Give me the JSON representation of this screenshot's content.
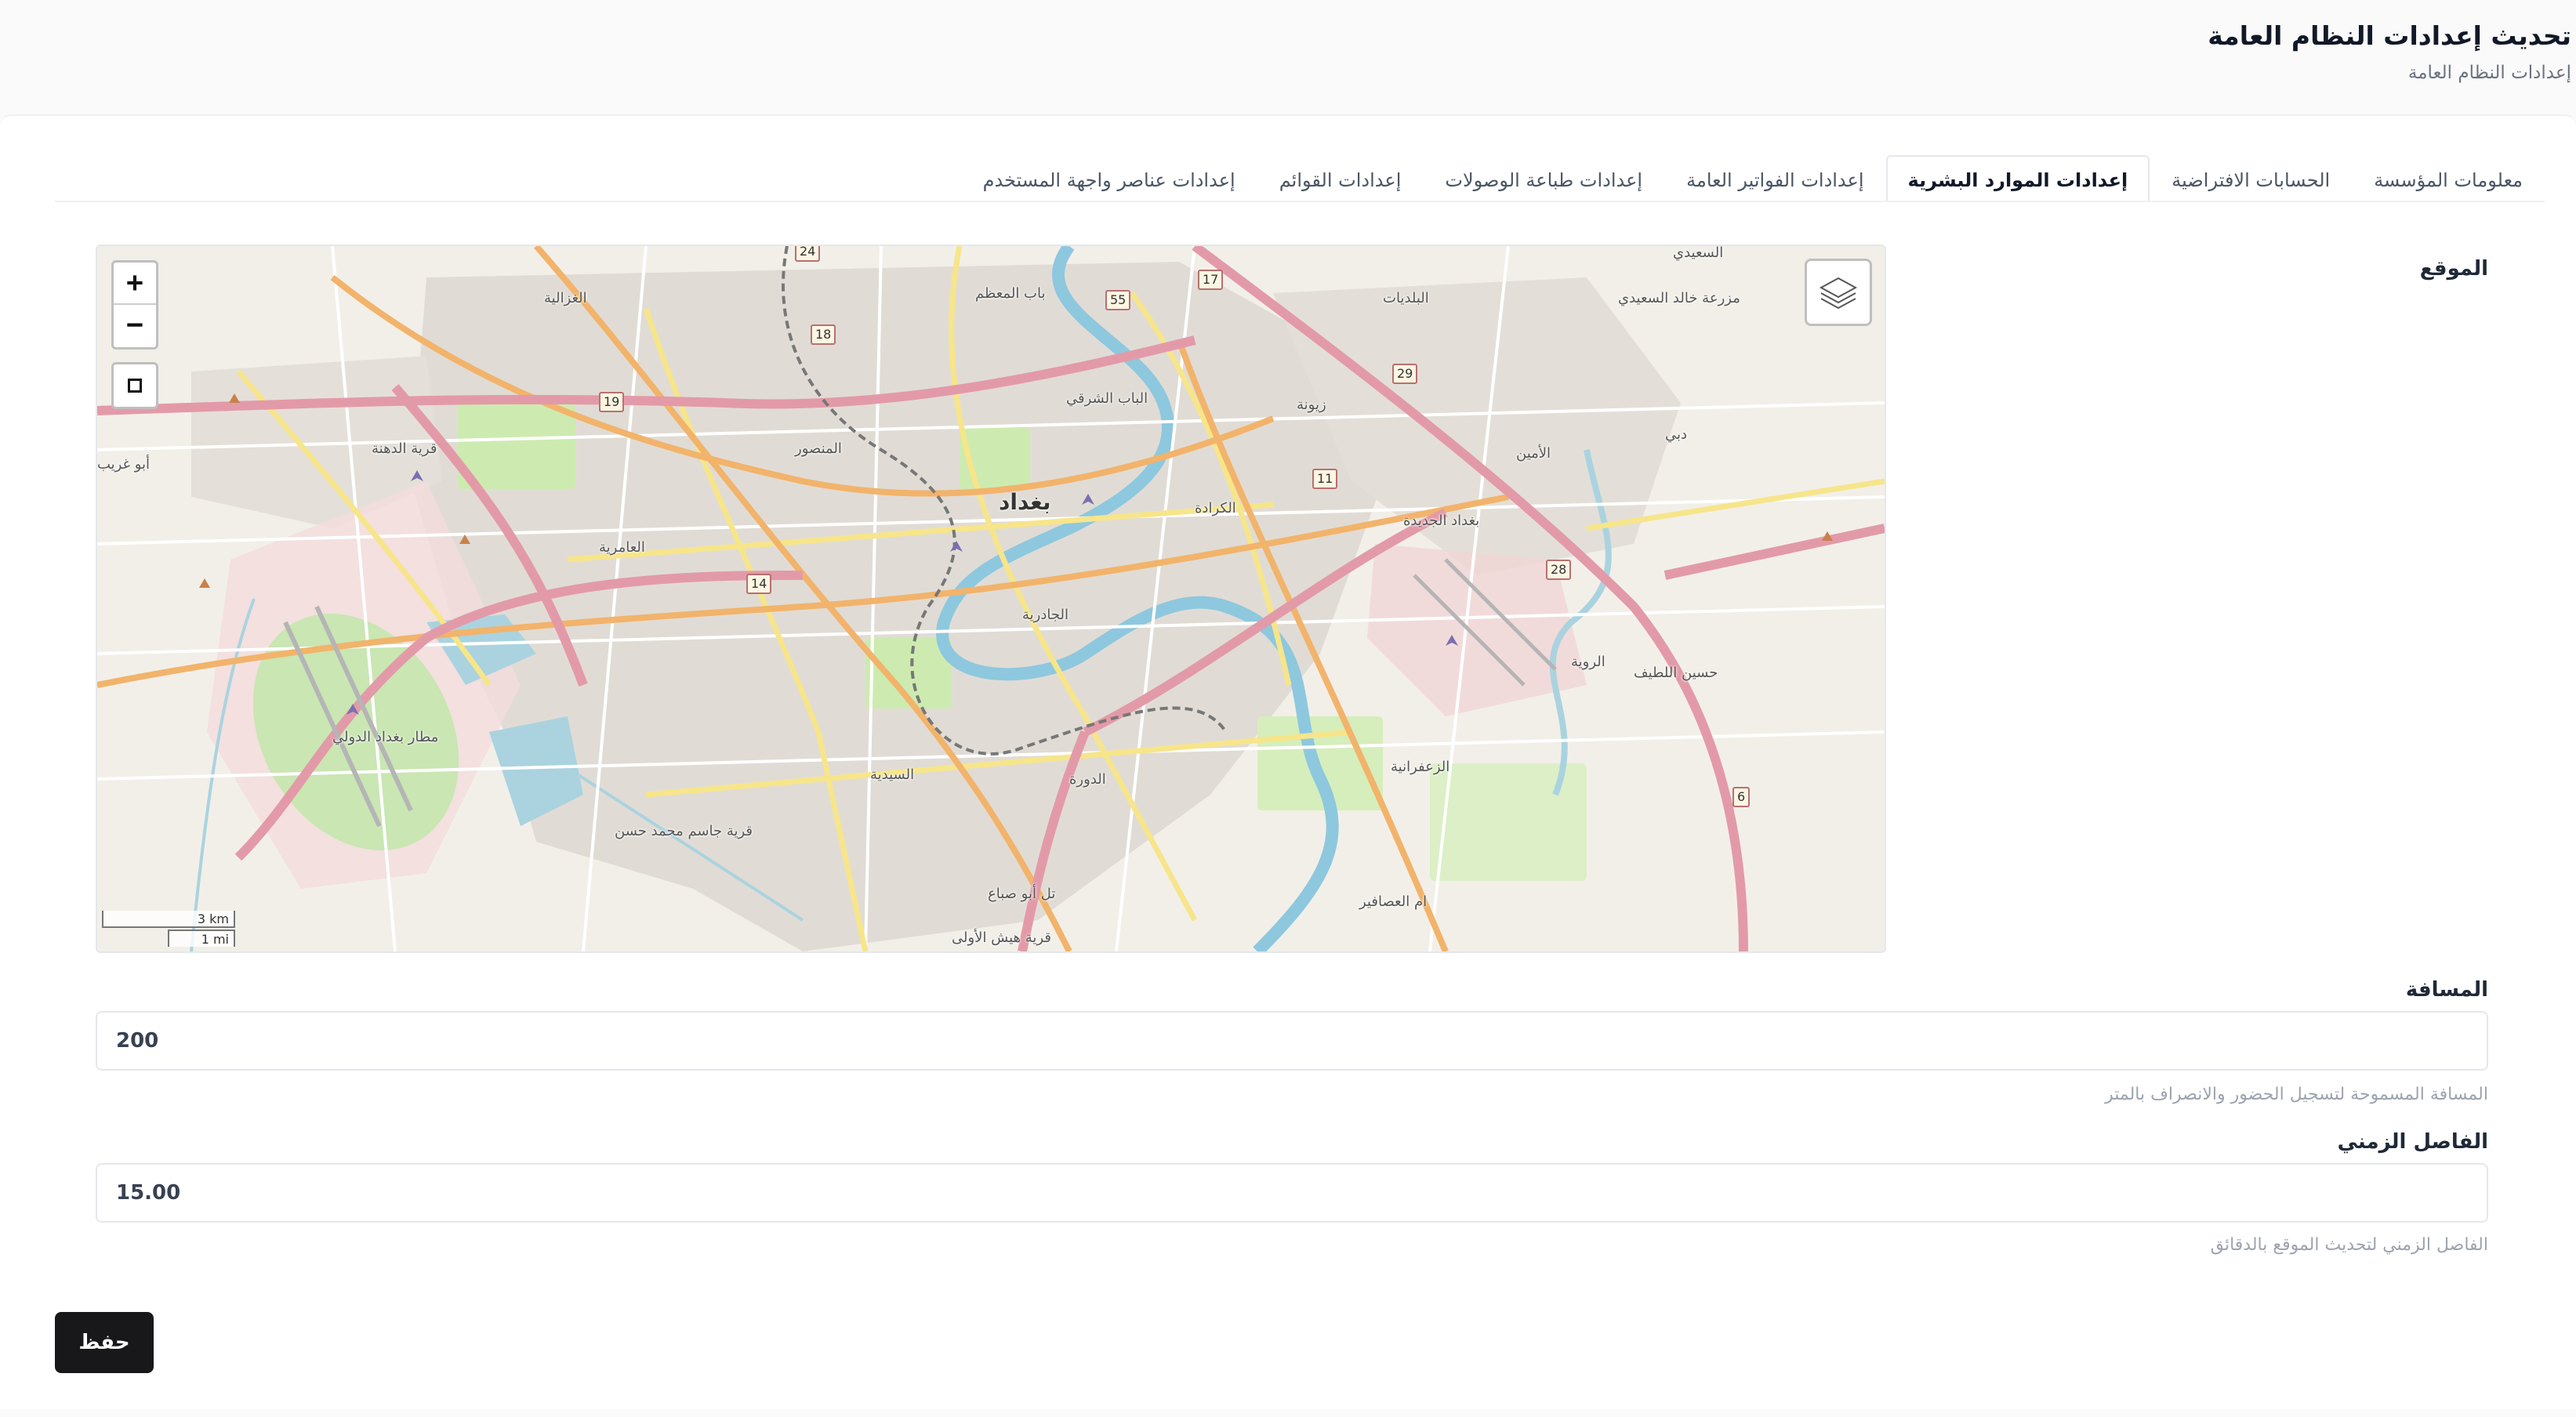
{
  "header": {
    "title": "تحديث إعدادات النظام العامة",
    "breadcrumb": "إعدادات النظام العامة"
  },
  "tabs": [
    {
      "label": "معلومات المؤسسة",
      "active": false
    },
    {
      "label": "الحسابات الافتراضية",
      "active": false
    },
    {
      "label": "إعدادات الموارد البشرية",
      "active": true
    },
    {
      "label": "إعدادات الفواتير العامة",
      "active": false
    },
    {
      "label": "إعدادات طباعة الوصولات",
      "active": false
    },
    {
      "label": "إعدادات القوائم",
      "active": false
    },
    {
      "label": "إعدادات عناصر واجهة المستخدم",
      "active": false
    }
  ],
  "location": {
    "label": "الموقع",
    "map": {
      "zoom_in": "+",
      "zoom_out": "−",
      "scale_km": "3 km",
      "scale_mi": "1 mi",
      "labels": {
        "baghdad": "بغداد",
        "ghazaliya": "الغزالية",
        "bab_muadham": "باب المعظم",
        "baladiyat": "البلديات",
        "saeedi": "السعيدي",
        "khalid_farm": "مزرعة خالد السعيدي",
        "bab_sharqi": "الباب الشرقي",
        "zayouna": "زيونة",
        "mansour": "المنصور",
        "dahna": "قرية الدهنة",
        "abu_ghraib": "أبو غريب",
        "amin": "الأمين",
        "karrada": "الكرادة",
        "baghdad_jadida": "بغداد الجديدة",
        "amiriya": "العامرية",
        "jadiriya": "الجادرية",
        "rawiya": "الروية",
        "hussein": "حسين اللطيف",
        "airport": "مطار بغداد الدولي",
        "zafaraniya": "الزعفرانية",
        "saydiya": "السيدية",
        "dora": "الدورة",
        "jassim": "قرية جاسم محمد حسن",
        "tal_abu": "تل أبو صباع",
        "asafir": "ام العصافير",
        "hayyash": "قرية هيش الأولى",
        "dubai": "دبي"
      },
      "shields": [
        "24",
        "17",
        "55",
        "18",
        "29",
        "19",
        "11",
        "14",
        "28",
        "6"
      ]
    }
  },
  "distance": {
    "label": "المسافة",
    "value": "200",
    "help": "المسافة المسموحة لتسجيل الحضور والانصراف بالمتر"
  },
  "interval": {
    "label": "الفاصل الزمني",
    "value": "15.00",
    "help": "الفاصل الزمني لتحديث الموقع بالدقائق"
  },
  "actions": {
    "save_label": "حفظ"
  }
}
